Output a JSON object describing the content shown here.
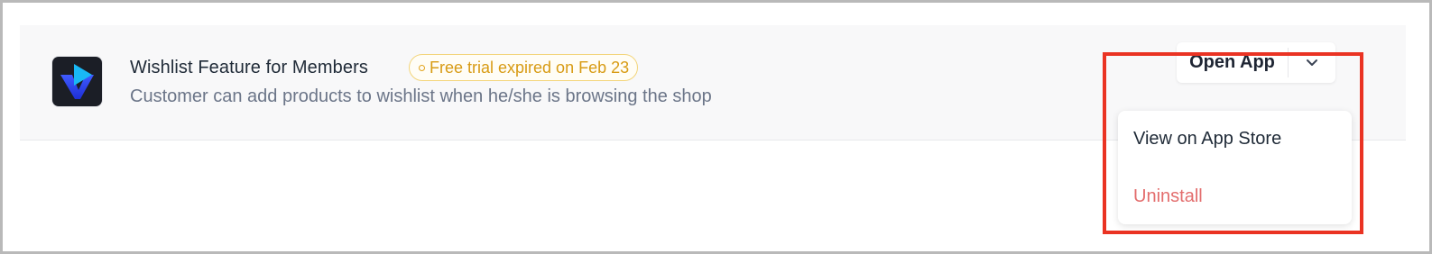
{
  "app": {
    "title": "Wishlist Feature for Members",
    "badge_text": "Free trial expired on Feb 23",
    "description": "Customer can add products to wishlist when he/she is browsing the shop",
    "icon": "app-logo-v-play"
  },
  "actions": {
    "open_label": "Open App",
    "chevron_icon": "chevron-down-icon"
  },
  "menu": {
    "items": [
      {
        "label": "View on App Store",
        "color": "#1f2a37"
      },
      {
        "label": "Uninstall",
        "color": "#e36d6d"
      }
    ]
  },
  "colors": {
    "badge_border": "#f3d57b",
    "badge_text": "#d89b14",
    "highlight": "#ea3323",
    "row_background": "#f8f8f9"
  }
}
